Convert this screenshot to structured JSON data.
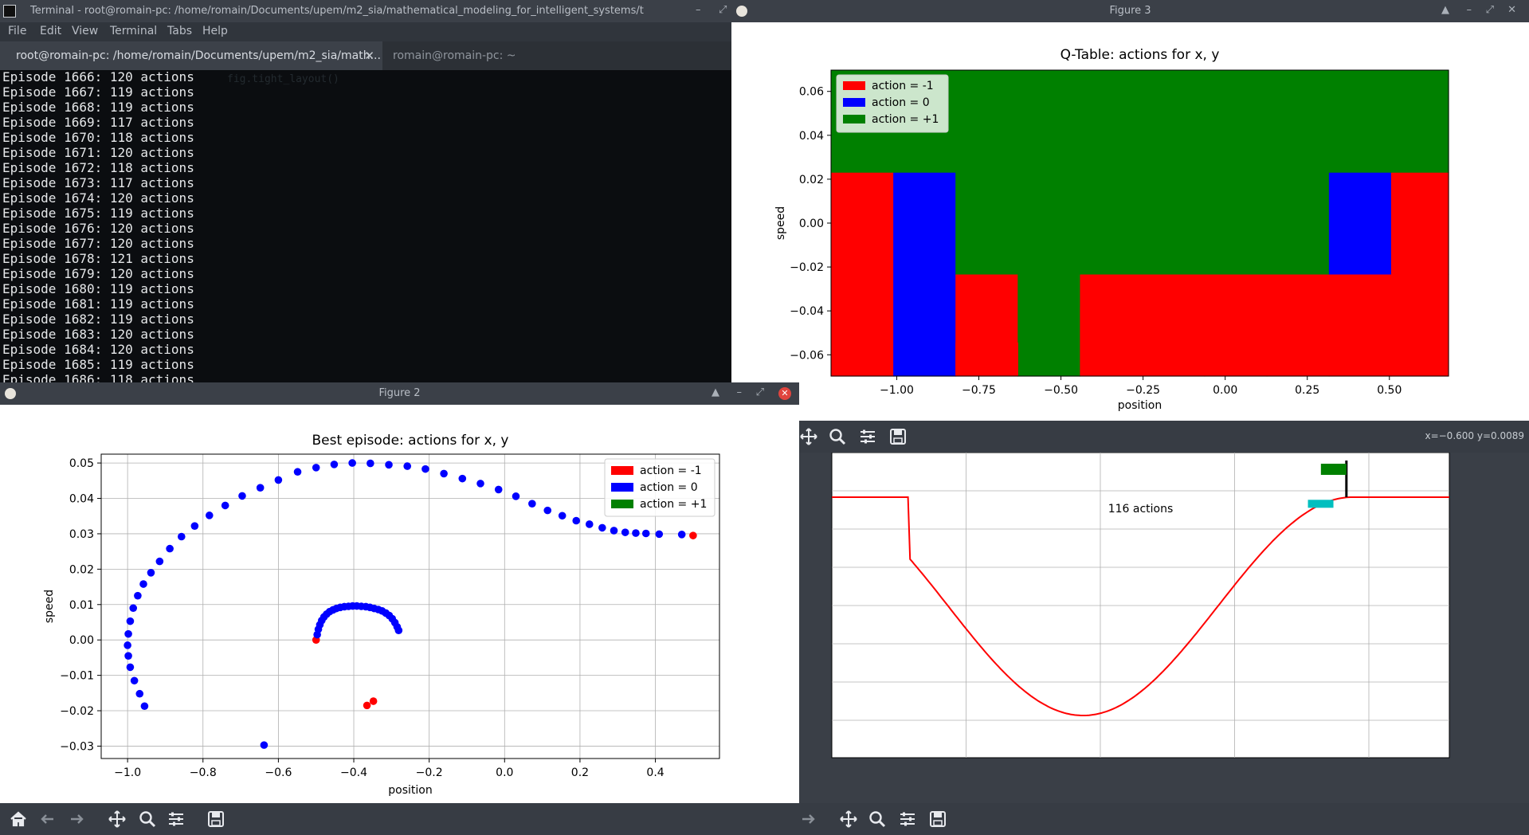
{
  "terminal": {
    "title": "Terminal - root@romain-pc: /home/romain/Documents/upem/m2_sia/mathematical_modeling_for_intelligent_systems/t",
    "menu": [
      "File",
      "Edit",
      "View",
      "Terminal",
      "Tabs",
      "Help"
    ],
    "tabs": [
      {
        "label": "root@romain-pc: /home/romain/Documents/upem/m2_sia/math..."
      },
      {
        "label": "romain@romain-pc: ~"
      }
    ],
    "lines": [
      "Episode 1666: 120 actions",
      "Episode 1667: 119 actions",
      "Episode 1668: 119 actions",
      "Episode 1669: 117 actions",
      "Episode 1670: 118 actions",
      "Episode 1671: 120 actions",
      "Episode 1672: 118 actions",
      "Episode 1673: 117 actions",
      "Episode 1674: 120 actions",
      "Episode 1675: 119 actions",
      "Episode 1676: 120 actions",
      "Episode 1677: 120 actions",
      "Episode 1678: 121 actions",
      "Episode 1679: 120 actions",
      "Episode 1680: 119 actions",
      "Episode 1681: 119 actions",
      "Episode 1682: 119 actions",
      "Episode 1683: 120 actions",
      "Episode 1684: 120 actions",
      "Episode 1685: 119 actions",
      "Episode 1686: 118 actions"
    ]
  },
  "figure3": {
    "title": "Figure 3",
    "coords": "x=−0.600 y=0.0089"
  },
  "figure2": {
    "title": "Figure 2"
  },
  "colors": {
    "red": "#ff0000",
    "blue": "#0000ff",
    "green": "#008000",
    "cyan": "#00bfbf"
  },
  "chart_data": [
    {
      "type": "heatmap",
      "title": "Q-Table: actions for x, y",
      "xlabel": "position",
      "ylabel": "speed",
      "xlim": [
        -1.2,
        0.68
      ],
      "ylim": [
        -0.0697,
        0.0697
      ],
      "xticks": [
        -1.0,
        -0.75,
        -0.5,
        -0.25,
        0.0,
        0.25,
        0.5
      ],
      "xtick_labels": [
        "−1.00",
        "−0.75",
        "−0.50",
        "−0.25",
        "0.00",
        "0.25",
        "0.50"
      ],
      "yticks": [
        -0.06,
        -0.04,
        -0.02,
        0.0,
        0.02,
        0.04,
        0.06
      ],
      "ytick_labels": [
        "−0.06",
        "−0.04",
        "−0.02",
        "0.00",
        "0.02",
        "0.04",
        "0.06"
      ],
      "x_edges": [
        -1.2,
        -1.0105,
        -0.8211,
        -0.6316,
        -0.4421,
        -0.2526,
        -0.0632,
        0.1263,
        0.3158,
        0.5053,
        0.68
      ],
      "y_edges": [
        -0.0697,
        -0.0232,
        0.0232,
        0.0697
      ],
      "grid": [
        [
          -1,
          0,
          -1,
          1,
          -1,
          -1,
          -1,
          -1,
          -1,
          -1
        ],
        [
          -1,
          0,
          1,
          1,
          1,
          1,
          1,
          1,
          0,
          -1
        ],
        [
          1,
          1,
          1,
          1,
          1,
          1,
          1,
          1,
          1,
          1
        ]
      ],
      "overlays": [
        {
          "x0": -0.8211,
          "x1": -0.6316,
          "y0": -0.0697,
          "y1": -0.0544,
          "action": -1
        },
        {
          "x0": -0.4421,
          "x1": -0.2526,
          "y0": -0.0697,
          "y1": -0.0383,
          "action": -1
        },
        {
          "x0": -0.2526,
          "x1": 0.1263,
          "y0": -0.0697,
          "y1": -0.0544,
          "action": -1
        },
        {
          "x0": 0.1263,
          "x1": 0.3158,
          "y0": -0.0697,
          "y1": -0.0383,
          "action": -1
        }
      ],
      "legend": {
        "placement": "upper-left",
        "entries": [
          {
            "label": "action = -1",
            "color": "#ff0000"
          },
          {
            "label": "action = 0",
            "color": "#0000ff"
          },
          {
            "label": "action = +1",
            "color": "#008000"
          }
        ]
      }
    },
    {
      "type": "scatter",
      "title": "Best episode: actions for x, y",
      "xlabel": "position",
      "ylabel": "speed",
      "xlim": [
        -1.07,
        0.57
      ],
      "ylim": [
        -0.0335,
        0.0525
      ],
      "grid": true,
      "xticks": [
        -1.0,
        -0.8,
        -0.6,
        -0.4,
        -0.2,
        0.0,
        0.2,
        0.4
      ],
      "xtick_labels": [
        "−1.0",
        "−0.8",
        "−0.6",
        "−0.4",
        "−0.2",
        "0.0",
        "0.2",
        "0.4"
      ],
      "yticks": [
        -0.03,
        -0.02,
        -0.01,
        0.0,
        0.01,
        0.02,
        0.03,
        0.04,
        0.05
      ],
      "ytick_labels": [
        "−0.03",
        "−0.02",
        "−0.01",
        "0.00",
        "0.01",
        "0.02",
        "0.03",
        "0.04",
        "0.05"
      ],
      "legend": {
        "placement": "upper-right",
        "entries": [
          {
            "label": "action = -1",
            "color": "#ff0000"
          },
          {
            "label": "action = 0",
            "color": "#0000ff"
          },
          {
            "label": "action = +1",
            "color": "#008000"
          }
        ]
      },
      "series": [
        {
          "action": -1,
          "color": "#ff0000",
          "points": [
            [
              -0.5,
              0.0
            ],
            [
              -0.365,
              -0.0185
            ],
            [
              -0.348,
              -0.0173
            ],
            [
              0.5,
              0.0295
            ]
          ]
        },
        {
          "action": 0,
          "color": "#0000ff",
          "points": [
            [
              -0.497,
              0.0015
            ],
            [
              -0.494,
              0.003
            ],
            [
              -0.49,
              0.0043
            ],
            [
              -0.485,
              0.0055
            ],
            [
              -0.479,
              0.0065
            ],
            [
              -0.472,
              0.0073
            ],
            [
              -0.464,
              0.008
            ],
            [
              -0.455,
              0.0085
            ],
            [
              -0.446,
              0.0089
            ],
            [
              -0.436,
              0.0092
            ],
            [
              -0.425,
              0.0094
            ],
            [
              -0.414,
              0.0095
            ],
            [
              -0.403,
              0.0096
            ],
            [
              -0.392,
              0.0096
            ],
            [
              -0.38,
              0.0095
            ],
            [
              -0.368,
              0.0094
            ],
            [
              -0.357,
              0.0092
            ],
            [
              -0.346,
              0.0089
            ],
            [
              -0.335,
              0.0086
            ],
            [
              -0.325,
              0.0082
            ],
            [
              -0.315,
              0.0076
            ],
            [
              -0.306,
              0.0069
            ],
            [
              -0.298,
              0.006
            ],
            [
              -0.291,
              0.0049
            ],
            [
              -0.285,
              0.0037
            ],
            [
              -0.281,
              0.0027
            ],
            [
              -0.638,
              -0.0297
            ],
            [
              -0.955,
              -0.0187
            ],
            [
              -0.968,
              -0.0152
            ],
            [
              -0.982,
              -0.0115
            ],
            [
              -0.993,
              -0.0077
            ],
            [
              -0.998,
              -0.0045
            ],
            [
              -1.0,
              -0.0015
            ],
            [
              -0.998,
              0.0017
            ],
            [
              -0.993,
              0.0053
            ],
            [
              -0.985,
              0.009
            ],
            [
              -0.973,
              0.0125
            ],
            [
              -0.958,
              0.0158
            ],
            [
              -0.938,
              0.019
            ],
            [
              -0.915,
              0.0222
            ],
            [
              -0.888,
              0.0258
            ],
            [
              -0.857,
              0.0292
            ],
            [
              -0.822,
              0.0322
            ],
            [
              -0.783,
              0.0352
            ],
            [
              -0.741,
              0.038
            ],
            [
              -0.696,
              0.0407
            ],
            [
              -0.648,
              0.043
            ],
            [
              -0.6,
              0.0452
            ],
            [
              -0.549,
              0.0475
            ],
            [
              -0.5,
              0.0487
            ],
            [
              -0.452,
              0.0496
            ],
            [
              -0.404,
              0.05
            ],
            [
              -0.356,
              0.0499
            ],
            [
              -0.307,
              0.0495
            ],
            [
              -0.258,
              0.0491
            ],
            [
              -0.21,
              0.0483
            ],
            [
              -0.161,
              0.047
            ],
            [
              -0.112,
              0.0456
            ],
            [
              -0.064,
              0.0442
            ],
            [
              -0.016,
              0.0425
            ],
            [
              0.03,
              0.0406
            ],
            [
              0.073,
              0.0385
            ],
            [
              0.114,
              0.0366
            ],
            [
              0.153,
              0.0351
            ],
            [
              0.19,
              0.0337
            ],
            [
              0.225,
              0.0327
            ],
            [
              0.259,
              0.0317
            ],
            [
              0.29,
              0.0309
            ],
            [
              0.32,
              0.0304
            ],
            [
              0.348,
              0.0302
            ],
            [
              0.375,
              0.0301
            ],
            [
              0.41,
              0.0299
            ],
            [
              0.47,
              0.0298
            ]
          ]
        },
        {
          "action": 1,
          "color": "#008000",
          "points": []
        }
      ]
    }
  ],
  "render": {
    "actions_label": "116 actions",
    "car_position": 0.4,
    "flag_position": 0.5
  }
}
